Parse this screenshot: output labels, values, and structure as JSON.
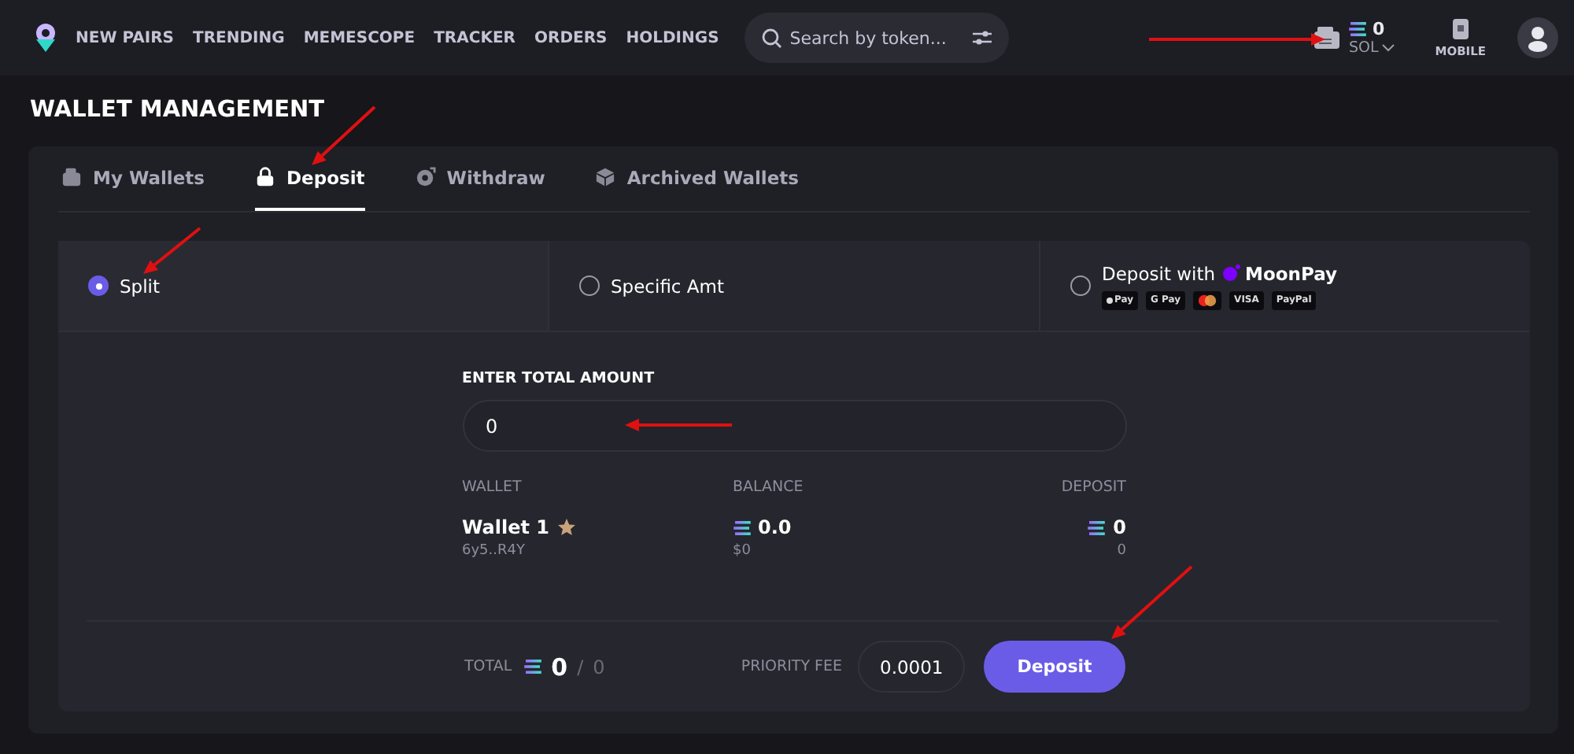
{
  "nav": {
    "links": [
      {
        "label": "NEW PAIRS"
      },
      {
        "label": "TRENDING"
      },
      {
        "label": "MEMESCOPE"
      },
      {
        "label": "TRACKER"
      },
      {
        "label": "ORDERS"
      },
      {
        "label": "HOLDINGS"
      }
    ],
    "search": {
      "placeholder": "Search by token..."
    },
    "balance": "0",
    "currency": "SOL",
    "mobile": "MOBILE"
  },
  "page_title": "WALLET MANAGEMENT",
  "tabs": [
    {
      "label": "My Wallets",
      "selected": false
    },
    {
      "label": "Deposit",
      "selected": true
    },
    {
      "label": "Withdraw",
      "selected": false
    },
    {
      "label": "Archived Wallets",
      "selected": false
    }
  ],
  "options": [
    {
      "label": "Split",
      "selected": true
    },
    {
      "label": "Specific Amt",
      "selected": false
    },
    {
      "label": "Deposit with",
      "brand": "MoonPay",
      "payment_badges": [
        {
          "kind": "apple",
          "text": "Pay"
        },
        {
          "kind": "google",
          "text": "G Pay"
        },
        {
          "kind": "mastercard"
        },
        {
          "kind": "visa",
          "text": "VISA"
        },
        {
          "kind": "paypal",
          "text": "PayPal"
        }
      ],
      "selected": false
    }
  ],
  "amount": {
    "label": "ENTER TOTAL AMOUNT",
    "value": "0"
  },
  "table": {
    "columns": [
      "WALLET",
      "BALANCE",
      "DEPOSIT"
    ],
    "rows": [
      {
        "name": "Wallet 1",
        "address": "6y5..R4Y",
        "balance": "0.0",
        "balance_usd": "$0",
        "deposit": "0",
        "deposit_sub": "0"
      }
    ]
  },
  "footer": {
    "total_label": "TOTAL",
    "total": "0",
    "separator": "/",
    "total_max": "0",
    "fee_label": "PRIORITY FEE",
    "fee": "0.0001",
    "button": "Deposit"
  }
}
